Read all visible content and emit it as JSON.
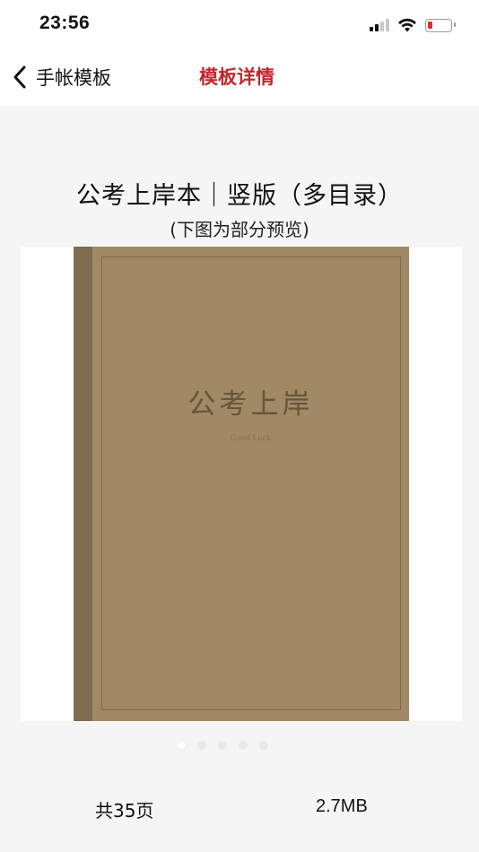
{
  "status_bar": {
    "time": "23:56",
    "battery_color": "#e0302e"
  },
  "nav": {
    "back_label": "手帐模板",
    "title": "模板详情",
    "title_color": "#c0282d",
    "back_icon": "chevron-left-icon"
  },
  "template": {
    "title": "公考上岸本｜竖版（多目录）",
    "subtitle": "(下图为部分预览)",
    "cover_title": "公考上岸",
    "cover_subtitle": "Good Luck",
    "cover_color": "#a08964"
  },
  "carousel": {
    "total_pages": 5,
    "active_index": 0
  },
  "info": {
    "page_count": "共35页",
    "file_size": "2.7MB"
  }
}
